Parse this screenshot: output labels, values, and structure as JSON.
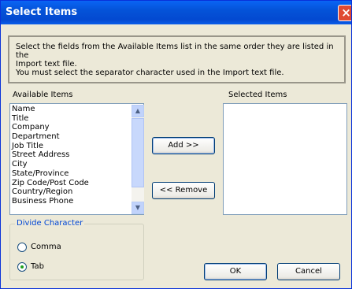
{
  "window": {
    "title": "Select Items",
    "close_glyph": "×"
  },
  "info": {
    "line1": "Select the fields from the Available Items list in the same order they are listed in the",
    "line2": "Import text file.",
    "line3": "You must select the separator character used in the Import text file."
  },
  "available": {
    "label": "Available Items",
    "items": [
      "Name",
      "Title",
      "Company",
      "Department",
      "Job Title",
      "Street Address",
      "City",
      "State/Province",
      "Zip Code/Post Code",
      "Country/Region",
      "Business Phone"
    ]
  },
  "selected": {
    "label": "Selected Items",
    "items": []
  },
  "buttons": {
    "add": "Add >>",
    "remove": "<< Remove",
    "ok": "OK",
    "cancel": "Cancel"
  },
  "divide": {
    "title": "Divide Character",
    "options": [
      "Comma",
      "Tab"
    ],
    "selected": "Tab"
  },
  "scrollbar": {
    "up_glyph": "▲",
    "down_glyph": "▼"
  }
}
